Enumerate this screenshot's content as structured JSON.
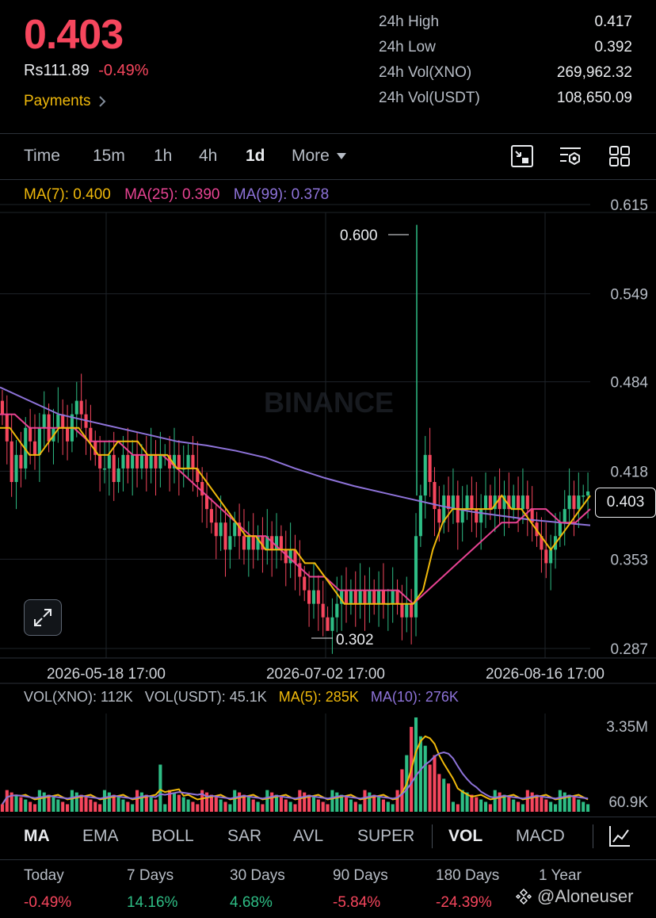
{
  "header": {
    "price": "0.403",
    "fiat_price": "Rs111.89",
    "change": "-0.49%",
    "payments_label": "Payments",
    "stats": [
      {
        "label": "24h High",
        "value": "0.417"
      },
      {
        "label": "24h Low",
        "value": "0.392"
      },
      {
        "label": "24h Vol(XNO)",
        "value": "269,962.32"
      },
      {
        "label": "24h Vol(USDT)",
        "value": "108,650.09"
      }
    ]
  },
  "timeframes": {
    "time": "Time",
    "m15": "15m",
    "h1": "1h",
    "h4": "4h",
    "d1": "1d",
    "more": "More",
    "active": "1d"
  },
  "tool_icons": [
    "chart-type-icon",
    "chart-settings-icon",
    "layout-grid-icon"
  ],
  "ma_legend": {
    "ma7": "MA(7): 0.400",
    "ma25": "MA(25): 0.390",
    "ma99": "MA(99): 0.378"
  },
  "price_axis": [
    "0.615",
    "0.549",
    "0.484",
    "0.418",
    "0.353",
    "0.287"
  ],
  "current_price_tag": "0.403",
  "high_marker": "0.600",
  "low_marker": "0.302",
  "watermark": "BINANCE",
  "date_labels": [
    "2026-05-18 17:00",
    "2026-07-02 17:00",
    "2026-08-16 17:00"
  ],
  "volume_legend": {
    "vol_xno": "VOL(XNO): 112K",
    "vol_usdt": "VOL(USDT): 45.1K",
    "ma5": "MA(5): 285K",
    "ma10": "MA(10): 276K"
  },
  "volume_axis": [
    "3.35M",
    "60.9K"
  ],
  "indicators": {
    "ma": "MA",
    "ema": "EMA",
    "boll": "BOLL",
    "sar": "SAR",
    "avl": "AVL",
    "super": "SUPER",
    "vol": "VOL",
    "macd": "MACD"
  },
  "performance": [
    {
      "label": "Today",
      "value": "-0.49%",
      "dir": "down"
    },
    {
      "label": "7 Days",
      "value": "14.16%",
      "dir": "up"
    },
    {
      "label": "30 Days",
      "value": "4.68%",
      "dir": "up"
    },
    {
      "label": "90 Days",
      "value": "-5.84%",
      "dir": "down"
    },
    {
      "label": "180 Days",
      "value": "-24.39%",
      "dir": "down"
    },
    {
      "label": "1 Year",
      "value": "",
      "dir": "down"
    }
  ],
  "user_watermark": "@Aloneuser",
  "colors": {
    "up": "#2EBD85",
    "down": "#F6465D",
    "accent": "#F0B90B",
    "ma7": "#F0B90B",
    "ma25": "#E84393",
    "ma99": "#8E73D9"
  },
  "chart_data": {
    "type": "candlestick",
    "date_labels": [
      "2026-05-18 17:00",
      "2026-07-02 17:00",
      "2026-08-16 17:00"
    ],
    "ylim": [
      0.287,
      0.615
    ],
    "high": 0.6,
    "low": 0.302,
    "last": 0.403,
    "closes": [
      0.46,
      0.44,
      0.41,
      0.43,
      0.42,
      0.45,
      0.44,
      0.43,
      0.45,
      0.46,
      0.44,
      0.45,
      0.46,
      0.45,
      0.44,
      0.46,
      0.47,
      0.46,
      0.45,
      0.44,
      0.43,
      0.42,
      0.42,
      0.43,
      0.41,
      0.42,
      0.43,
      0.42,
      0.43,
      0.42,
      0.43,
      0.42,
      0.43,
      0.42,
      0.43,
      0.43,
      0.42,
      0.43,
      0.42,
      0.42,
      0.43,
      0.42,
      0.41,
      0.4,
      0.39,
      0.38,
      0.37,
      0.38,
      0.36,
      0.37,
      0.38,
      0.37,
      0.36,
      0.37,
      0.36,
      0.37,
      0.36,
      0.37,
      0.36,
      0.37,
      0.36,
      0.35,
      0.36,
      0.35,
      0.34,
      0.33,
      0.32,
      0.33,
      0.32,
      0.31,
      0.3,
      0.31,
      0.32,
      0.33,
      0.32,
      0.33,
      0.32,
      0.33,
      0.32,
      0.33,
      0.32,
      0.33,
      0.32,
      0.32,
      0.33,
      0.32,
      0.31,
      0.32,
      0.31,
      0.37,
      0.4,
      0.43,
      0.41,
      0.39,
      0.38,
      0.4,
      0.39,
      0.4,
      0.38,
      0.39,
      0.4,
      0.39,
      0.38,
      0.39,
      0.4,
      0.39,
      0.4,
      0.39,
      0.4,
      0.39,
      0.4,
      0.39,
      0.4,
      0.39,
      0.38,
      0.37,
      0.36,
      0.35,
      0.36,
      0.37,
      0.38,
      0.39,
      0.4,
      0.39,
      0.4,
      0.4,
      0.403
    ],
    "ma7": [
      0.45,
      0.45,
      0.44,
      0.43,
      0.43,
      0.44,
      0.45,
      0.45,
      0.45,
      0.44,
      0.43,
      0.43,
      0.44,
      0.44,
      0.44,
      0.43,
      0.43,
      0.43,
      0.42,
      0.42,
      0.42,
      0.41,
      0.4,
      0.39,
      0.38,
      0.37,
      0.37,
      0.36,
      0.36,
      0.36,
      0.36,
      0.35,
      0.35,
      0.34,
      0.33,
      0.32,
      0.32,
      0.32,
      0.32,
      0.32,
      0.32,
      0.32,
      0.32,
      0.33,
      0.36,
      0.38,
      0.39,
      0.39,
      0.39,
      0.39,
      0.39,
      0.4,
      0.39,
      0.39,
      0.38,
      0.37,
      0.36,
      0.37,
      0.38,
      0.39,
      0.4
    ],
    "ma25": [
      0.46,
      0.46,
      0.45,
      0.45,
      0.45,
      0.45,
      0.44,
      0.44,
      0.44,
      0.43,
      0.43,
      0.43,
      0.42,
      0.41,
      0.4,
      0.39,
      0.38,
      0.37,
      0.37,
      0.36,
      0.35,
      0.34,
      0.34,
      0.33,
      0.33,
      0.33,
      0.33,
      0.33,
      0.32,
      0.33,
      0.34,
      0.35,
      0.36,
      0.37,
      0.38,
      0.38,
      0.39,
      0.39,
      0.38,
      0.38,
      0.39
    ],
    "ma99": [
      0.48,
      0.47,
      0.46,
      0.455,
      0.45,
      0.445,
      0.44,
      0.437,
      0.433,
      0.428,
      0.42,
      0.413,
      0.407,
      0.402,
      0.397,
      0.392,
      0.388,
      0.385,
      0.382,
      0.38,
      0.378
    ]
  }
}
